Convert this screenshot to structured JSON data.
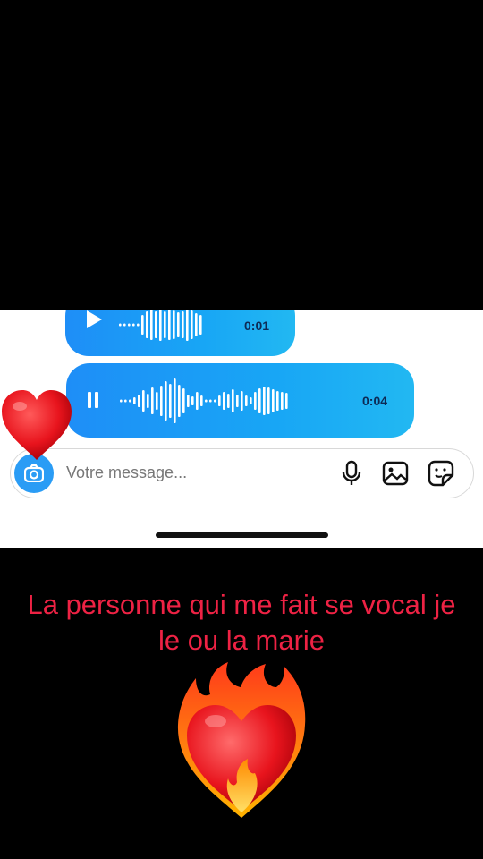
{
  "chat": {
    "voice_messages": [
      {
        "duration": "0:01",
        "state": "paused",
        "control_icon": "play-icon"
      },
      {
        "duration": "0:04",
        "state": "playing",
        "control_icon": "pause-icon"
      }
    ],
    "composer": {
      "placeholder": "Votre message...",
      "icons": [
        "camera-icon",
        "microphone-icon",
        "gallery-icon",
        "sticker-icon"
      ]
    }
  },
  "overlay": {
    "caption": "La personne qui me fait se vocal je le ou la marie",
    "emojis": [
      "red-heart-emoji",
      "heart-on-fire-emoji"
    ]
  },
  "colors": {
    "bubble_blue": "#1e8ef7",
    "caption_red": "#ee2244",
    "background": "#000000"
  }
}
